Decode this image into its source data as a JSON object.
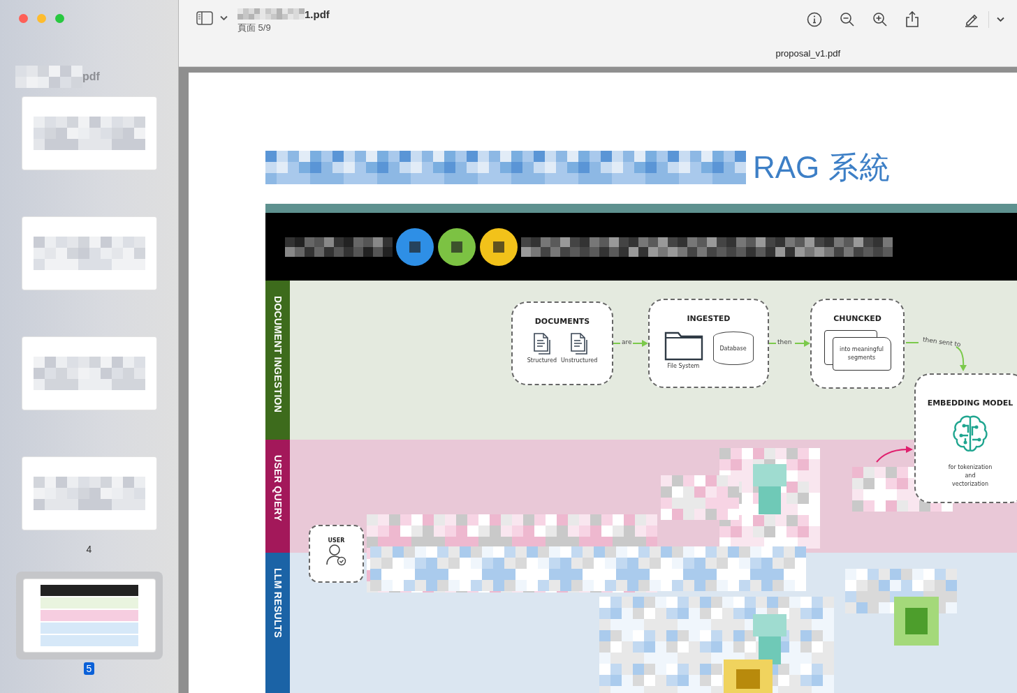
{
  "window": {
    "title": "1.pdf",
    "subtitle": "頁面 5/9",
    "tab_title": "proposal_v1.pdf"
  },
  "sidebar": {
    "heading": "pdf",
    "thumbnails": [
      {
        "selected": false
      },
      {
        "selected": false
      },
      {
        "selected": false
      },
      {
        "label": "4",
        "selected": false
      },
      {
        "label": "5",
        "selected": true
      }
    ]
  },
  "document": {
    "heading": "RAG 系統",
    "lanes": [
      {
        "label": "DOCUMENT INGESTION",
        "color": "#3d6b1c"
      },
      {
        "label": "USER QUERY",
        "color": "#a3185a"
      },
      {
        "label": "LLM RESULTS",
        "color": "#1b63a6"
      }
    ],
    "nodes": [
      {
        "kind": "documents",
        "title": "DOCUMENTS",
        "items": [
          "Structured",
          "Unstructured"
        ]
      },
      {
        "kind": "ingested",
        "title": "INGESTED",
        "items": [
          "File System",
          "Database"
        ]
      },
      {
        "kind": "chunked",
        "title": "CHUNCKED",
        "items": [
          "into meaningful segments"
        ]
      },
      {
        "kind": "embedding",
        "title": "EMBEDDING MODEL",
        "items": [
          "for tokenization",
          "and",
          "vectorization"
        ]
      },
      {
        "kind": "user",
        "title": "USER"
      }
    ],
    "connectors": [
      "are",
      "then",
      "then sent to"
    ]
  }
}
